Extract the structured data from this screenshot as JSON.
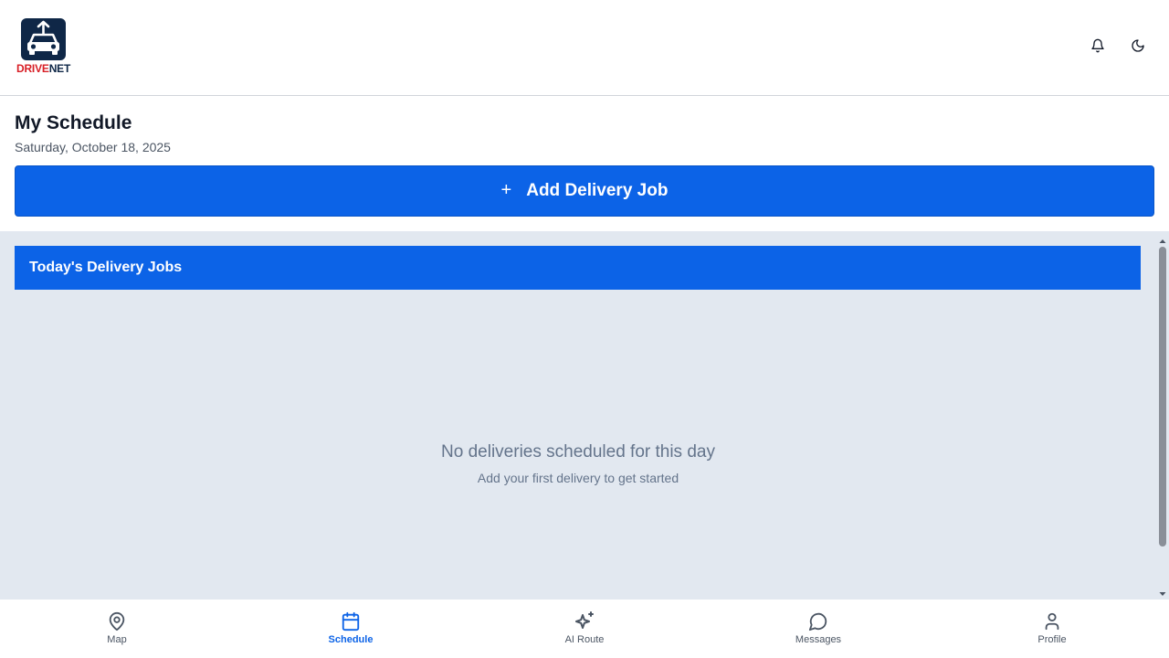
{
  "header": {
    "logo": {
      "text_red": "DRIVE",
      "text_navy": "NET"
    },
    "icons": {
      "notifications": "bell-icon",
      "theme": "moon-icon"
    }
  },
  "page": {
    "title": "My Schedule",
    "date": "Saturday, October 18, 2025"
  },
  "add_button": {
    "icon": "plus",
    "label": "Add Delivery Job"
  },
  "jobs_panel": {
    "title": "Today's Delivery Jobs",
    "empty_title": "No deliveries scheduled for this day",
    "empty_subtitle": "Add your first delivery to get started"
  },
  "nav": {
    "active": "Schedule",
    "items": [
      {
        "label": "Map",
        "icon": "map-pin-icon"
      },
      {
        "label": "Schedule",
        "icon": "calendar-icon"
      },
      {
        "label": "AI Route",
        "icon": "sparkles-icon"
      },
      {
        "label": "Messages",
        "icon": "chat-bubble-icon"
      },
      {
        "label": "Profile",
        "icon": "user-icon"
      }
    ]
  },
  "colors": {
    "primary": "#0c63e7",
    "brand_navy": "#0f2747",
    "brand_red": "#d81f26",
    "panel_bg": "#e2e8f0",
    "muted_text": "#64748b"
  }
}
